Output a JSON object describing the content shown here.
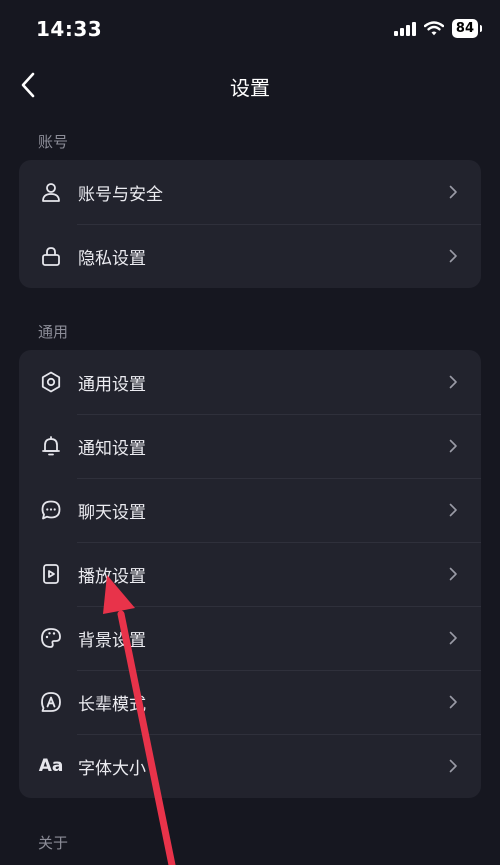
{
  "status_bar": {
    "time": "14:33",
    "battery": "84"
  },
  "header": {
    "title": "设置"
  },
  "sections": [
    {
      "title": "账号",
      "items": [
        {
          "label": "账号与安全",
          "icon": "user-icon"
        },
        {
          "label": "隐私设置",
          "icon": "lock-icon"
        }
      ]
    },
    {
      "title": "通用",
      "items": [
        {
          "label": "通用设置",
          "icon": "gear-icon"
        },
        {
          "label": "通知设置",
          "icon": "bell-icon"
        },
        {
          "label": "聊天设置",
          "icon": "chat-bubble-icon"
        },
        {
          "label": "播放设置",
          "icon": "play-icon"
        },
        {
          "label": "背景设置",
          "icon": "palette-icon"
        },
        {
          "label": "长辈模式",
          "icon": "elder-mode-icon"
        },
        {
          "label": "字体大小",
          "icon": "font-size-icon",
          "glyph": "Aa"
        }
      ]
    },
    {
      "title": "关于",
      "items": []
    }
  ],
  "colors": {
    "background": "#161720",
    "card": "#22232d",
    "annotation_arrow": "#e8334a"
  }
}
